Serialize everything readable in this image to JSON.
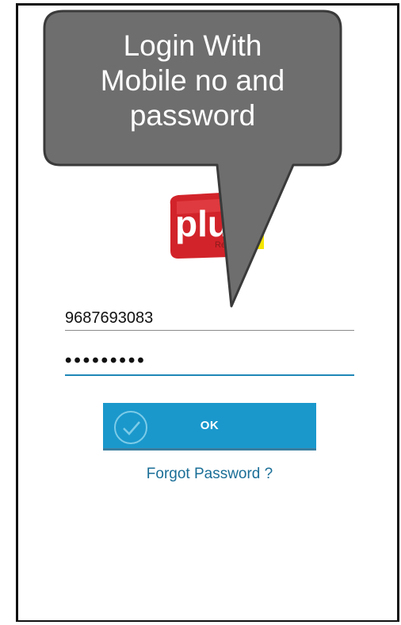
{
  "callout": {
    "line1": "Login With",
    "line2": "Mobile no and",
    "line3": "password"
  },
  "logo": {
    "text": "plu",
    "tag": "Re"
  },
  "login": {
    "mobile_value": "9687693083",
    "password_mask": "•••••••••",
    "ok_label": "OK",
    "forgot_label": "Forgot Password ?"
  },
  "colors": {
    "accent": "#1a98cc",
    "link": "#1a6e97",
    "callout_bg": "#6e6e6e",
    "logo_red": "#d2232a",
    "logo_yellow": "#f5e600"
  }
}
